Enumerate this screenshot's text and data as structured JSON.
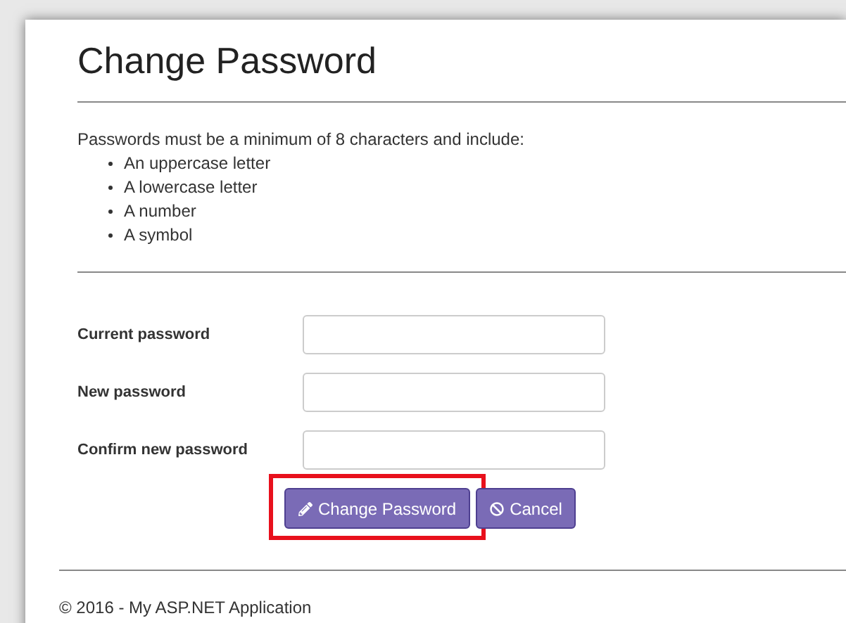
{
  "title": "Change Password",
  "intro": "Passwords must be a minimum of 8 characters and include:",
  "requirements": [
    "An uppercase letter",
    "A lowercase letter",
    "A number",
    "A symbol"
  ],
  "fields": [
    {
      "label": "Current password"
    },
    {
      "label": "New password"
    },
    {
      "label": "Confirm new password"
    }
  ],
  "buttons": [
    {
      "label": "Change Password",
      "kind": "submit",
      "highlighted": true
    },
    {
      "label": "Cancel",
      "kind": "cancel",
      "highlighted": false
    }
  ],
  "footer": "© 2016 - My ASP.NET Application"
}
